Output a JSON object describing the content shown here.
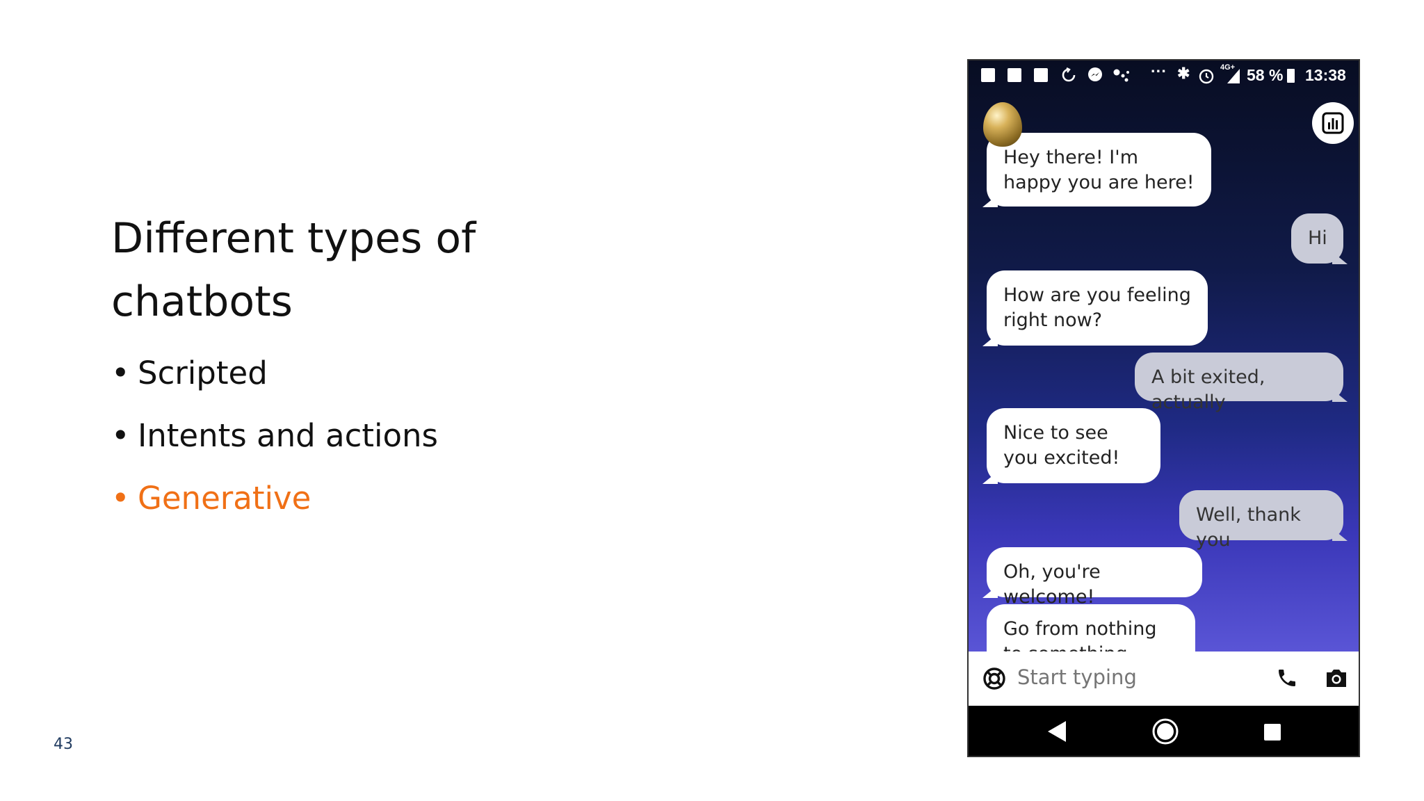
{
  "slide": {
    "title": "Different types of chatbots",
    "bullets": [
      {
        "text": "Scripted",
        "highlight": false
      },
      {
        "text": "Intents and actions",
        "highlight": false
      },
      {
        "text": "Generative",
        "highlight": true
      }
    ],
    "bullet_symbol": "•",
    "highlight_color": "#f07016",
    "page_number": "43"
  },
  "phone": {
    "status": {
      "notification_icons": [
        "app-icon",
        "app-icon",
        "app-icon",
        "sync-icon",
        "messenger-icon",
        "dots-icon"
      ],
      "more": "···",
      "bluetooth": "✱",
      "alarm": "⏰",
      "network": "4G+",
      "battery": "58 %",
      "time": "13:38"
    },
    "messages": [
      {
        "from": "bot",
        "text": "Hey there! I'm happy you are here!"
      },
      {
        "from": "user",
        "text": "Hi"
      },
      {
        "from": "bot",
        "text": "How are you feeling right now?"
      },
      {
        "from": "user",
        "text": "A bit exited, actually"
      },
      {
        "from": "bot",
        "text": "Nice to see you excited!"
      },
      {
        "from": "user",
        "text": "Well, thank you"
      },
      {
        "from": "bot",
        "text": "Oh, you're welcome!"
      },
      {
        "from": "bot",
        "text": "Go from nothing to something"
      }
    ],
    "input": {
      "placeholder": "Start typing"
    },
    "icons": {
      "stats": "bar-chart-icon",
      "help": "lifebuoy-icon",
      "call": "phone-icon",
      "camera": "camera-icon",
      "back": "back-triangle-icon",
      "home": "home-circle-icon",
      "recents": "recents-square-icon"
    },
    "colors": {
      "bot_bubble": "#ffffff",
      "user_bubble": "#c9cbd8",
      "bg_top": "#080d22",
      "bg_bottom": "#5a55d6"
    }
  }
}
